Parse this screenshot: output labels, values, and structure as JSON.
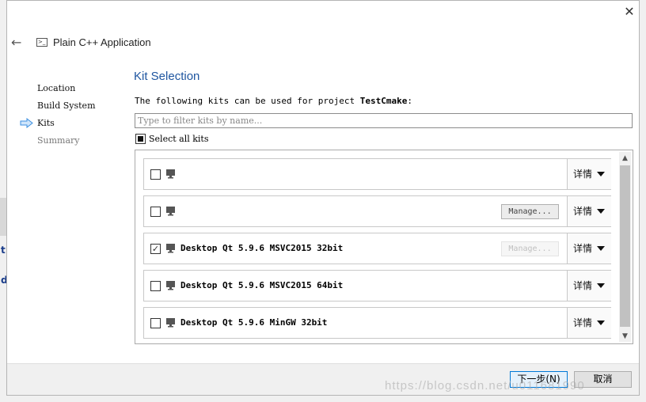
{
  "window": {
    "title": "Plain C++ Application",
    "close_glyph": "✕",
    "back_glyph": "←"
  },
  "steps": [
    {
      "label": "Location",
      "state": "done"
    },
    {
      "label": "Build System",
      "state": "done"
    },
    {
      "label": "Kits",
      "state": "current"
    },
    {
      "label": "Summary",
      "state": "pending"
    }
  ],
  "page": {
    "title": "Kit Selection",
    "intro_prefix": "The following kits can be used for project ",
    "project_name": "TestCmake",
    "intro_suffix": ":",
    "filter_placeholder": "Type to filter kits by name...",
    "select_all_label": "Select all kits",
    "select_all_state": "partial"
  },
  "kits": [
    {
      "name": "",
      "checked": false,
      "manage_label": "",
      "manage_state": "hidden",
      "details_label": "详情"
    },
    {
      "name": "",
      "checked": false,
      "manage_label": "Manage...",
      "manage_state": "enabled",
      "details_label": "详情"
    },
    {
      "name": "Desktop Qt 5.9.6 MSVC2015 32bit",
      "checked": true,
      "manage_label": "Manage...",
      "manage_state": "disabled",
      "details_label": "详情"
    },
    {
      "name": "Desktop Qt 5.9.6 MSVC2015 64bit",
      "checked": false,
      "manage_label": "",
      "manage_state": "hidden",
      "details_label": "详情"
    },
    {
      "name": "Desktop Qt 5.9.6 MinGW 32bit",
      "checked": false,
      "manage_label": "",
      "manage_state": "hidden",
      "details_label": "详情"
    }
  ],
  "footer": {
    "next_label": "下一步(N)",
    "cancel_label": "取消"
  },
  "background": {
    "letter1": "t",
    "letter2": "d"
  },
  "watermark": "https://blog.csdn.net/u011681990",
  "colors": {
    "accent": "#1f56a0",
    "primary_button_border": "#0078d7",
    "arrow_blue": "#3b8fe0"
  },
  "icons": {
    "step_arrow": "right-arrow-icon",
    "kit": "monitor-icon"
  }
}
